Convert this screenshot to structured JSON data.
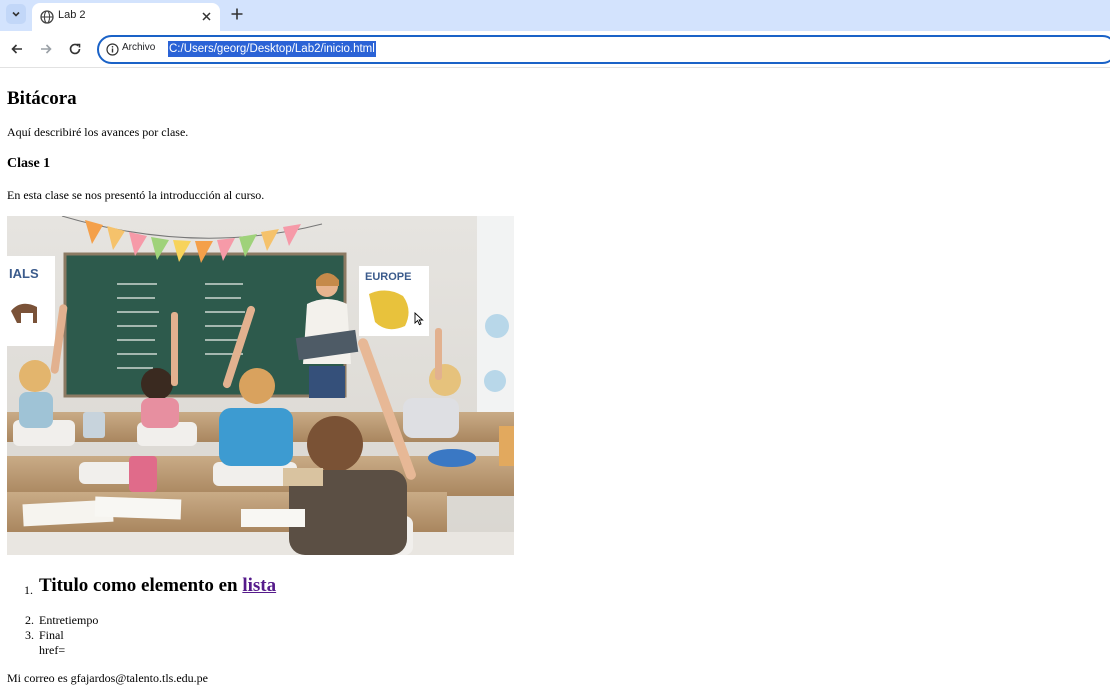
{
  "browser": {
    "tab": {
      "title": "Lab 2"
    },
    "address": {
      "chip": "Archivo",
      "url": "C:/Users/georg/Desktop/Lab2/inicio.html"
    }
  },
  "page": {
    "title": "Bitácora",
    "intro": "Aquí describiré los avances por clase.",
    "section_title": "Clase 1",
    "section_text": "En esta clase se nos presentó la introducción al curso.",
    "list": {
      "item1_text": "Titulo como elemento en ",
      "item1_link": "lista",
      "item2": "Entretiempo",
      "item3": "Final",
      "extra_text": "href=",
      "numbers": [
        "1.",
        "2.",
        "3."
      ]
    },
    "email_line": "Mi correo es gfajardos@talento.tls.edu.pe",
    "photo": {
      "board_left_label": "IALS",
      "board_right_label": "EUROPE"
    }
  },
  "colors": {
    "tabstrip": "#d3e3fd",
    "omnibox_border": "#1a62c7",
    "url_highlight": "#2b63d6",
    "visited_link": "#551a8b"
  }
}
